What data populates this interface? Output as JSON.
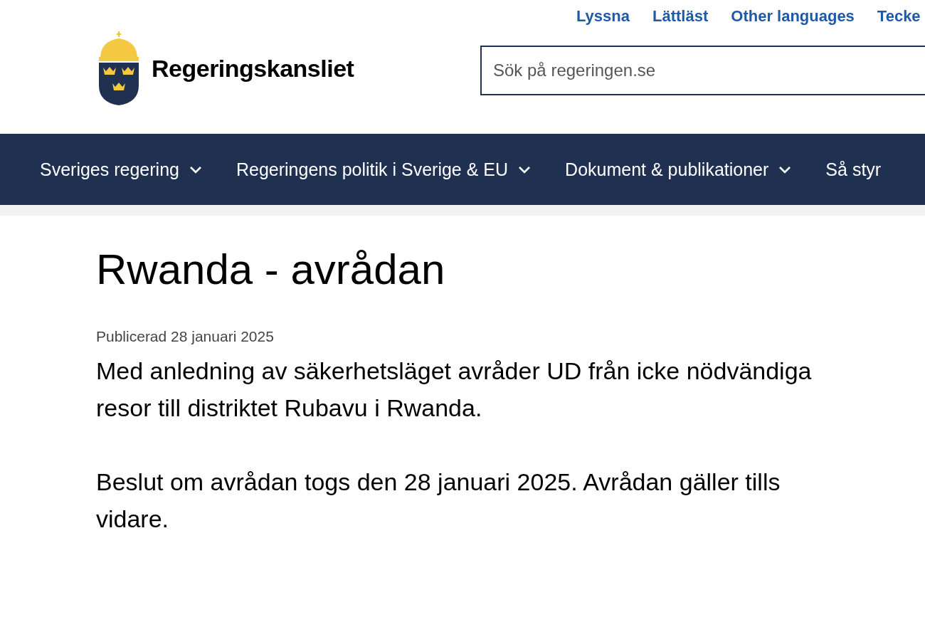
{
  "top_links": [
    "Lyssna",
    "Lättläst",
    "Other languages",
    "Tecke"
  ],
  "logo": {
    "name": "Regeringskansliet"
  },
  "search": {
    "placeholder": "Sök på regeringen.se"
  },
  "nav": [
    {
      "label": "Sveriges regering",
      "kind": "dropdown"
    },
    {
      "label": "Regeringens politik i Sverige & EU",
      "kind": "dropdown"
    },
    {
      "label": "Dokument & publikationer",
      "kind": "dropdown"
    },
    {
      "label": "Så styr",
      "kind": "link"
    }
  ],
  "article": {
    "title": "Rwanda - avrådan",
    "published": "Publicerad 28 januari 2025",
    "paragraphs": [
      "Med anledning av säkerhetsläget avråder UD från icke nödvändiga resor till distriktet Rubavu i Rwanda.",
      "Beslut om avrådan togs den 28 januari 2025. Avrådan gäller tills vidare."
    ]
  }
}
